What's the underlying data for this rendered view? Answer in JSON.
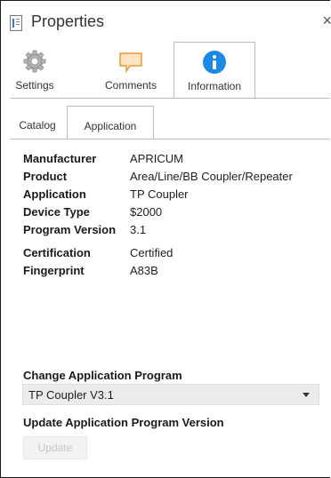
{
  "panel": {
    "title": "Properties",
    "close_glyph": "×"
  },
  "big_tabs": [
    {
      "label": "Settings",
      "icon": "gear-icon"
    },
    {
      "label": "Comments",
      "icon": "comment-icon"
    },
    {
      "label": "Information",
      "icon": "info-icon",
      "active": true
    }
  ],
  "small_tabs": [
    {
      "label": "Catalog"
    },
    {
      "label": "Application",
      "active": true
    }
  ],
  "properties": {
    "manufacturer": {
      "key": "Manufacturer",
      "value": "APRICUM"
    },
    "product": {
      "key": "Product",
      "value": "Area/Line/BB Coupler/Repeater"
    },
    "application": {
      "key": "Application",
      "value": "TP Coupler"
    },
    "device_type": {
      "key": "Device Type",
      "value": "$2000"
    },
    "program_version": {
      "key": "Program Version",
      "value": "3.1"
    },
    "certification": {
      "key": "Certification",
      "value": "Certified"
    },
    "fingerprint": {
      "key": "Fingerprint",
      "value": "A83B"
    }
  },
  "change_app": {
    "title": "Change Application Program",
    "selected": "TP Coupler V3.1"
  },
  "update_version": {
    "title": "Update Application Program Version",
    "button_label": "Update"
  },
  "colors": {
    "info_blue": "#1e88e5",
    "comment_orange": "#f0a040",
    "gear_grey": "#9a9a9a"
  }
}
